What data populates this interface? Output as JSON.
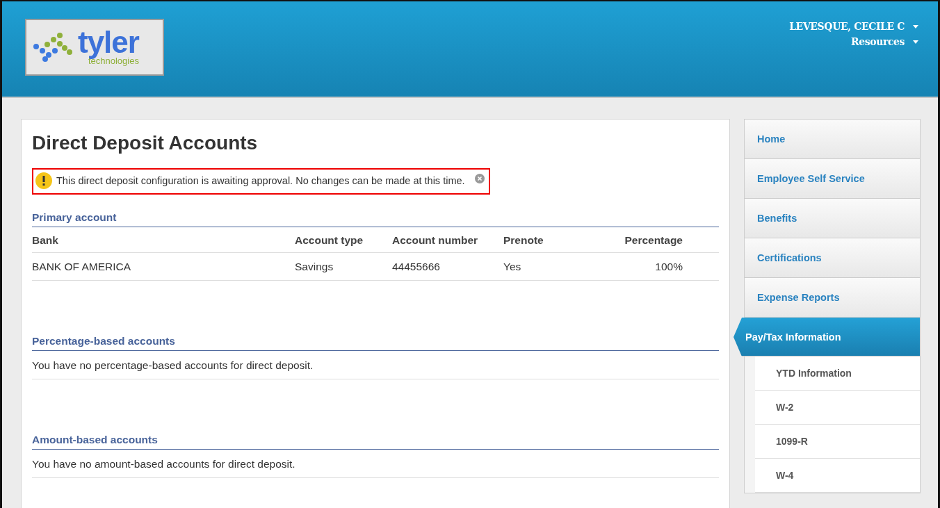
{
  "header": {
    "logo": {
      "name": "tyler",
      "tagline": "technologies"
    },
    "menus": [
      {
        "label": "LEVESQUE, CECILE C"
      },
      {
        "label": "Resources"
      }
    ]
  },
  "page": {
    "title": "Direct Deposit Accounts",
    "alert": {
      "message": "This direct deposit configuration is awaiting approval. No changes can be made at this time."
    },
    "sections": [
      {
        "kind": "table",
        "title": "Primary account",
        "columns": [
          "Bank",
          "Account type",
          "Account number",
          "Prenote",
          "Percentage"
        ],
        "rows": [
          [
            "BANK OF AMERICA",
            "Savings",
            "44455666",
            "Yes",
            "100%"
          ]
        ]
      },
      {
        "kind": "message",
        "title": "Percentage-based accounts",
        "message": "You have no percentage-based accounts for direct deposit."
      },
      {
        "kind": "message",
        "title": "Amount-based accounts",
        "message": "You have no amount-based accounts for direct deposit."
      }
    ]
  },
  "sidebar": {
    "items": [
      {
        "label": "Home",
        "selected": false
      },
      {
        "label": "Employee Self Service",
        "selected": false
      },
      {
        "label": "Benefits",
        "selected": false
      },
      {
        "label": "Certifications",
        "selected": false
      },
      {
        "label": "Expense Reports",
        "selected": false
      },
      {
        "label": "Pay/Tax Information",
        "selected": true,
        "children": [
          {
            "label": "YTD Information"
          },
          {
            "label": "W-2"
          },
          {
            "label": "1099-R"
          },
          {
            "label": "W-4"
          }
        ]
      }
    ]
  }
}
